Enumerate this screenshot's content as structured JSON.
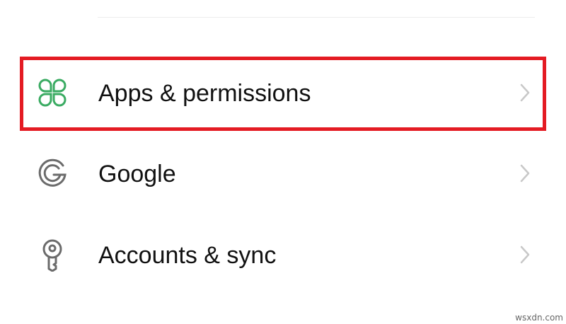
{
  "settings": {
    "items": [
      {
        "id": "apps",
        "label": "Apps & permissions",
        "icon": "four-leaf-icon",
        "icon_color": "#3aab62",
        "highlighted": true
      },
      {
        "id": "google",
        "label": "Google",
        "icon": "google-g-icon",
        "icon_color": "#6b6b6b",
        "highlighted": false
      },
      {
        "id": "accounts",
        "label": "Accounts & sync",
        "icon": "key-icon",
        "icon_color": "#6b6b6b",
        "highlighted": false
      }
    ]
  },
  "highlight": {
    "color": "#e41b23"
  },
  "chevron_color": "#c8c8c8",
  "watermark": "wsxdn.com"
}
